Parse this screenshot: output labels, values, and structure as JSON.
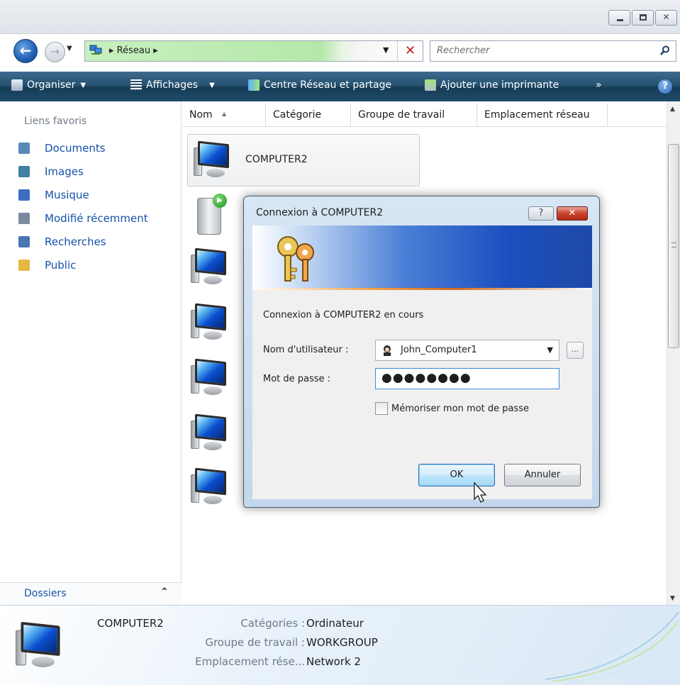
{
  "window": {
    "minimize_icon": "minimize-icon",
    "maximize_icon": "maximize-icon",
    "close_glyph": "✕"
  },
  "address_bar": {
    "path": "Réseau",
    "network_icon": "network-icon",
    "search_placeholder": "Rechercher"
  },
  "toolbar": {
    "organize": "Organiser",
    "views": "Affichages",
    "network_center": "Centre Réseau et partage",
    "add_printer": "Ajouter une imprimante",
    "more": "»",
    "help": "?"
  },
  "nav": {
    "heading": "Liens favoris",
    "items": [
      {
        "label": "Documents",
        "icon": "documents-icon",
        "color": "#5a88b8"
      },
      {
        "label": "Images",
        "icon": "images-icon",
        "color": "#3f7fa0"
      },
      {
        "label": "Musique",
        "icon": "music-icon",
        "color": "#3d6fc0"
      },
      {
        "label": "Modifié récemment",
        "icon": "recent-icon",
        "color": "#7c8aa0"
      },
      {
        "label": "Recherches",
        "icon": "searches-icon",
        "color": "#4a77b4"
      },
      {
        "label": "Public",
        "icon": "folder-icon",
        "color": "#e6b840"
      }
    ],
    "folders": "Dossiers"
  },
  "columns": [
    "Nom",
    "Catégorie",
    "Groupe de travail",
    "Emplacement réseau"
  ],
  "items": {
    "selected": "COMPUTER2"
  },
  "details": {
    "name": "COMPUTER2",
    "rows": [
      {
        "label": "Catégories :",
        "value": "Ordinateur"
      },
      {
        "label": "Groupe de travail :",
        "value": "WORKGROUP"
      },
      {
        "label": "Emplacement rése...",
        "value": "Network 2"
      }
    ]
  },
  "dialog": {
    "title": "Connexion à COMPUTER2",
    "help": "?",
    "close": "✕",
    "status": "Connexion à COMPUTER2 en cours",
    "username_label": "Nom d'utilisateur :",
    "username_value": "John_Computer1",
    "browse": "...",
    "password_label": "Mot de passe :",
    "password_mask": "●●●●●●●●",
    "remember_label": "Mémoriser mon mot de passe",
    "remember_checked": false,
    "ok": "OK",
    "cancel": "Annuler"
  },
  "colors": {
    "toolbar_bg": "#24506f",
    "link_blue": "#1552a8",
    "close_red": "#c9432d"
  }
}
